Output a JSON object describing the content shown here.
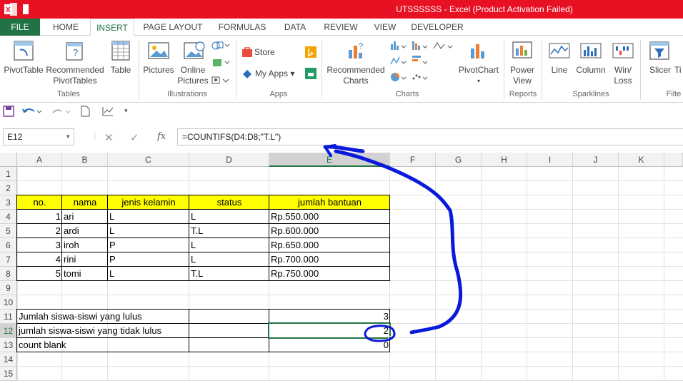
{
  "window": {
    "title": "UTSSSSSS -  Excel (Product Activation Failed)"
  },
  "tabs": [
    {
      "label": "FILE"
    },
    {
      "label": "HOME"
    },
    {
      "label": "INSERT"
    },
    {
      "label": "PAGE LAYOUT"
    },
    {
      "label": "FORMULAS"
    },
    {
      "label": "DATA"
    },
    {
      "label": "REVIEW"
    },
    {
      "label": "VIEW"
    },
    {
      "label": "DEVELOPER"
    }
  ],
  "ribbon": {
    "pivottable": "PivotTable",
    "recommended_pivot_1": "Recommended",
    "recommended_pivot_2": "PivotTables",
    "table": "Table",
    "group_tables": "Tables",
    "pictures": "Pictures",
    "online_pictures_1": "Online",
    "online_pictures_2": "Pictures",
    "group_illustrations": "Illustrations",
    "store": "Store",
    "my_apps": "My Apps",
    "group_apps": "Apps",
    "recommended_charts_1": "Recommended",
    "recommended_charts_2": "Charts",
    "group_charts": "Charts",
    "pivotchart": "PivotChart",
    "power_view_1": "Power",
    "power_view_2": "View",
    "group_reports": "Reports",
    "line": "Line",
    "column": "Column",
    "winloss_1": "Win/",
    "winloss_2": "Loss",
    "group_sparklines": "Sparklines",
    "slicer": "Slicer",
    "timeline": "Ti",
    "group_filters": "Filte"
  },
  "formula_bar": {
    "name_box": "E12",
    "formula": "=COUNTIFS(D4:D8;\"T.L\")",
    "fx": "fx"
  },
  "columns": [
    "A",
    "B",
    "C",
    "D",
    "E",
    "F",
    "G",
    "H",
    "I",
    "J",
    "K"
  ],
  "rows": [
    "1",
    "2",
    "3",
    "4",
    "5",
    "6",
    "7",
    "8",
    "9",
    "10",
    "11",
    "12",
    "13",
    "14",
    "15"
  ],
  "table": {
    "headers": [
      "no.",
      "nama",
      "jenis kelamin",
      "status",
      "jumlah bantuan"
    ],
    "rows": [
      [
        "1",
        "ari",
        "L",
        "L",
        "Rp.550.000"
      ],
      [
        "2",
        "ardi",
        "L",
        "T.L",
        "Rp.600.000"
      ],
      [
        "3",
        "iroh",
        "P",
        "L",
        "Rp.650.000"
      ],
      [
        "4",
        "rini",
        "P",
        "L",
        "Rp.700.000"
      ],
      [
        "5",
        "tomi",
        "L",
        "T.L",
        "Rp.750.000"
      ]
    ]
  },
  "summary": [
    {
      "label": "Jumlah siswa-siswi yang lulus",
      "value": "3"
    },
    {
      "label": "jumlah siswa-siswi yang tidak lulus",
      "value": "2"
    },
    {
      "label": "count blank",
      "value": "0"
    }
  ],
  "colors": {
    "excel_green": "#217346",
    "title_red": "#e81123",
    "header_yellow": "#ffff00",
    "annotation_blue": "#0a1adb"
  }
}
